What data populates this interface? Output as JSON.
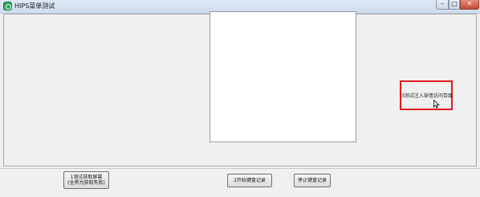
{
  "window": {
    "title": "HIPS菜单测试",
    "controls": {
      "minimize": "–",
      "maximize": "□",
      "close": "✕"
    }
  },
  "buttons": {
    "inject": "3测试注入穿墙访问百度",
    "capture_line1": "1测试获取屏幕",
    "capture_line2": "(全黑为获取失败)",
    "start_keylog": "2开始键盘记录",
    "stop_keylog": "停止键盘记录"
  },
  "colors": {
    "highlight": "#e01c1c",
    "titlebar": "#dfe9f5",
    "close_button": "#c74a37"
  },
  "icons": [
    "app-icon",
    "cursor-icon"
  ]
}
